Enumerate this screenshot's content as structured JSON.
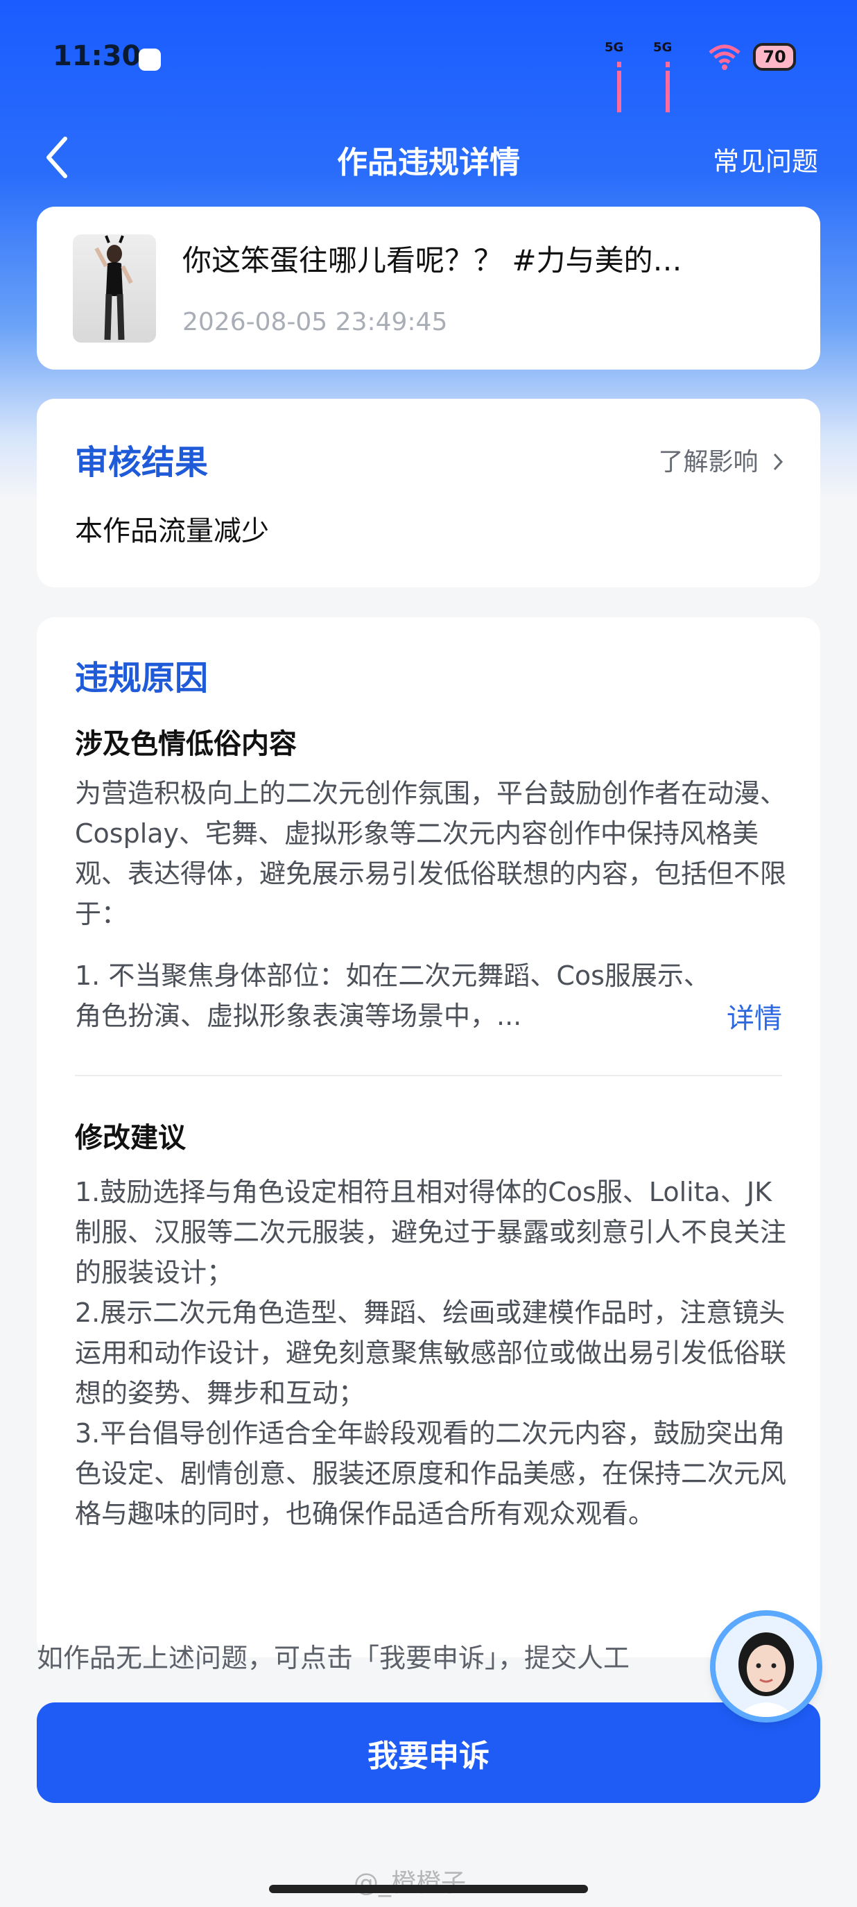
{
  "status_bar": {
    "time": "11:30",
    "net1": "5G",
    "net2": "5G",
    "battery": "70"
  },
  "nav": {
    "title": "作品违规详情",
    "faq": "常见问题"
  },
  "work": {
    "title": "你这笨蛋往哪儿看呢？？ #力与美的…",
    "time": "2026-08-05 23:49:45"
  },
  "result": {
    "heading": "审核结果",
    "learn_more": "了解影响",
    "text": "本作品流量减少"
  },
  "reason": {
    "heading": "违规原因",
    "type": "涉及色情低俗内容",
    "description": "为营造积极向上的二次元创作氛围，平台鼓励创作者在动漫、Cosplay、宅舞、虚拟形象等二次元内容创作中保持风格美观、表达得体，避免展示易引发低俗联想的内容，包括但不限于：",
    "item1": "1. 不当聚焦身体部位：如在二次元舞蹈、Cos服展示、角色扮演、虚拟形象表演等场景中，...",
    "detail_link": "详情",
    "suggest_heading": "修改建议",
    "suggestions": [
      "1.鼓励选择与角色设定相符且相对得体的Cos服、Lolita、JK制服、汉服等二次元服装，避免过于暴露或刻意引人不良关注的服装设计；",
      "2.展示二次元角色造型、舞蹈、绘画或建模作品时，注意镜头运用和动作设计，避免刻意聚焦敏感部位或做出易引发低俗联想的姿势、舞步和互动；",
      "3.平台倡导创作适合全年龄段观看的二次元内容，鼓励突出角色设定、剧情创意、服装还原度和作品美感，在保持二次元风格与趣味的同时，也确保作品适合所有观众观看。"
    ]
  },
  "footer": {
    "hint": "如作品无上述问题，可点击「我要申诉」，提交人工",
    "appeal_button": "我要申诉",
    "watermark": "@_橙橙子"
  },
  "colors": {
    "accent": "#1e5cf5",
    "heading_blue": "#1f5bd8"
  }
}
